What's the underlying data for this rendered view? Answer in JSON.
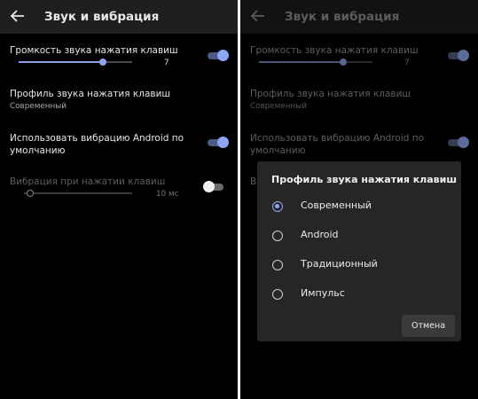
{
  "left": {
    "title": "Звук и вибрация",
    "key_volume": {
      "label": "Громкость звука нажатия клавиш",
      "value": "7",
      "level": 0.74,
      "enabled": true
    },
    "key_profile": {
      "label": "Профиль звука нажатия клавиш",
      "value": "Современный"
    },
    "use_android_vibration": {
      "label_line1": "Использовать вибрацию Android по",
      "label_line2": "умолчанию",
      "enabled": true
    },
    "key_vibration": {
      "label": "Вибрация при нажатии клавиш",
      "value": "10 мс",
      "level": 0.08,
      "enabled": false
    }
  },
  "right": {
    "title": "Звук и вибрация",
    "key_volume": {
      "label": "Громкость звука нажатия клавиш",
      "value": "7",
      "level": 0.74
    },
    "key_profile": {
      "label": "Профиль звука нажатия клавиш",
      "value": "Современный"
    },
    "use_android_vibration": {
      "label_line1": "Использовать вибрацию Android по",
      "label_line2": "умолчанию"
    },
    "key_vibration_partial": "В",
    "dialog": {
      "title": "Профиль звука нажатия клавиш",
      "options": [
        {
          "label": "Современный",
          "selected": true
        },
        {
          "label": "Android",
          "selected": false
        },
        {
          "label": "Традиционный",
          "selected": false
        },
        {
          "label": "Импульс",
          "selected": false
        }
      ],
      "cancel_label": "Отмена"
    }
  },
  "colors": {
    "accent": "#8ea5f4",
    "background": "#000000",
    "topbar": "#1f1f1f",
    "dialog": "#262626"
  },
  "icons": {
    "back": "arrow-left-icon"
  }
}
